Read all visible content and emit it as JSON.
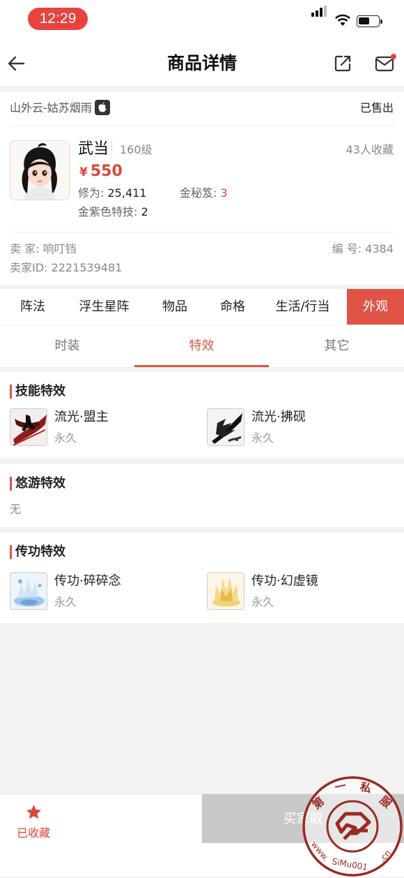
{
  "status_bar": {
    "time": "12:29"
  },
  "nav": {
    "title": "商品详情"
  },
  "listing": {
    "server": "山外云-姑苏烟雨",
    "status": "已售出",
    "school": "武当",
    "level": "160级",
    "favorites": "43人收藏",
    "price_symbol": "¥",
    "price": "550",
    "xiuwei_label": "修为:",
    "xiuwei_value": "25,411",
    "jinmiqian_label": "金秘笈:",
    "jinmiqian_value": "3",
    "tejia_label": "金紫色特技:",
    "tejia_value": "2",
    "seller_label": "卖 家:",
    "seller_name": "响叮铛",
    "code_label": "编 号:",
    "code_value": "4384",
    "seller_id_label": "卖家ID:",
    "seller_id_value": "2221539481"
  },
  "category_tabs": [
    "阵法",
    "浮生星阵",
    "物品",
    "命格",
    "生活/行当",
    "外观"
  ],
  "active_category": "外观",
  "sub_tabs": [
    "时装",
    "特效",
    "其它"
  ],
  "active_sub_tab": "特效",
  "sections": {
    "skill": {
      "title": "技能特效",
      "items": [
        {
          "name": "流光·盟主",
          "duration": "永久",
          "icon": "red-swordsman-effect-icon"
        },
        {
          "name": "流光·拂砚",
          "duration": "永久",
          "icon": "ink-splash-effect-icon"
        }
      ]
    },
    "wander": {
      "title": "悠游特效",
      "empty_text": "无"
    },
    "transfer": {
      "title": "传功特效",
      "items": [
        {
          "name": "传功·碎碎念",
          "duration": "永久",
          "icon": "blue-splash-effect-icon"
        },
        {
          "name": "传功·幻虚镜",
          "duration": "永久",
          "icon": "golden-crown-effect-icon"
        }
      ]
    }
  },
  "bottom_bar": {
    "favorite_label": "已收藏",
    "buy_label": "买家取"
  },
  "watermark": {
    "text_top": "第 一 私 服",
    "text_bottom": "www.SiMu001.cn"
  },
  "colors": {
    "accent": "#e05447",
    "price": "#d9463c",
    "time_pill": "#e8433f",
    "disabled_button": "#c8c8c8"
  }
}
